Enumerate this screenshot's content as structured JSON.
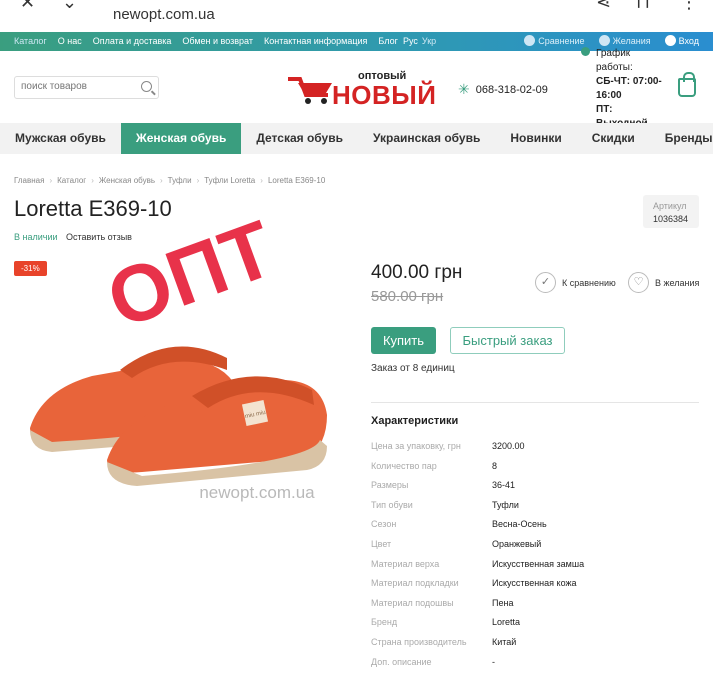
{
  "browser": {
    "url": "newopt.com.ua"
  },
  "topbar": {
    "links": [
      "Каталог",
      "О нас",
      "Оплата и доставка",
      "Обмен и возврат",
      "Контактная информация",
      "Блог"
    ],
    "lang_active": "Рус",
    "lang_other": "Укр",
    "compare": "Сравнение",
    "wishlist": "Желания",
    "login": "Вход",
    "colors": {
      "start": "#3a9e7f",
      "end": "#2a8ed0"
    }
  },
  "header": {
    "search_placeholder": "поиск товаров",
    "logo_small": "оптовый",
    "logo_big": "НОВЫЙ",
    "phone": "068-318-02-09",
    "schedule_label": "График работы:",
    "schedule_days": "СБ-ЧТ:",
    "schedule_hours": "07:00-16:00",
    "schedule_off_day": "ПТ:",
    "schedule_off": "Выходной"
  },
  "nav": {
    "items": [
      "Мужская обувь",
      "Женская обувь",
      "Детская обувь",
      "Украинская обувь",
      "Новинки",
      "Скидки",
      "Бренды"
    ],
    "active_index": 1,
    "accent": "#3a9e7f"
  },
  "breadcrumb": [
    "Главная",
    "Каталог",
    "Женская обувь",
    "Туфли",
    "Туфли Loretta",
    "Loretta E369-10"
  ],
  "product": {
    "title": "Loretta E369-10",
    "availability": "В наличии",
    "review_link": "Оставить отзыв",
    "sku_label": "Артикул",
    "sku_value": "1036384",
    "discount": "-31%",
    "watermark_opt": "ОПТ",
    "watermark_site": "newopt.com.ua",
    "badge_text": "miu miu",
    "price": "400.00 грн",
    "old_price": "580.00 грн",
    "compare_label": "К сравнению",
    "wish_label": "В желания",
    "buy_label": "Купить",
    "quick_label": "Быстрый заказ",
    "min_order": "Заказ от 8 единиц",
    "shoe_color": "#e8643a"
  },
  "characteristics": {
    "title": "Характеристики",
    "rows": [
      {
        "k": "Цена за упаковку, грн",
        "v": "3200.00"
      },
      {
        "k": "Количество пар",
        "v": "8"
      },
      {
        "k": "Размеры",
        "v": "36-41"
      },
      {
        "k": "Тип обуви",
        "v": "Туфли"
      },
      {
        "k": "Сезон",
        "v": "Весна-Осень"
      },
      {
        "k": "Цвет",
        "v": "Оранжевый"
      },
      {
        "k": "Материал верха",
        "v": "Искусственная замша"
      },
      {
        "k": "Материал подкладки",
        "v": "Искусственная кожа"
      },
      {
        "k": "Материал подошвы",
        "v": "Пена"
      },
      {
        "k": "Бренд",
        "v": "Loretta"
      },
      {
        "k": "Страна производитель",
        "v": "Китай"
      },
      {
        "k": "Доп. описание",
        "v": "-"
      }
    ]
  }
}
